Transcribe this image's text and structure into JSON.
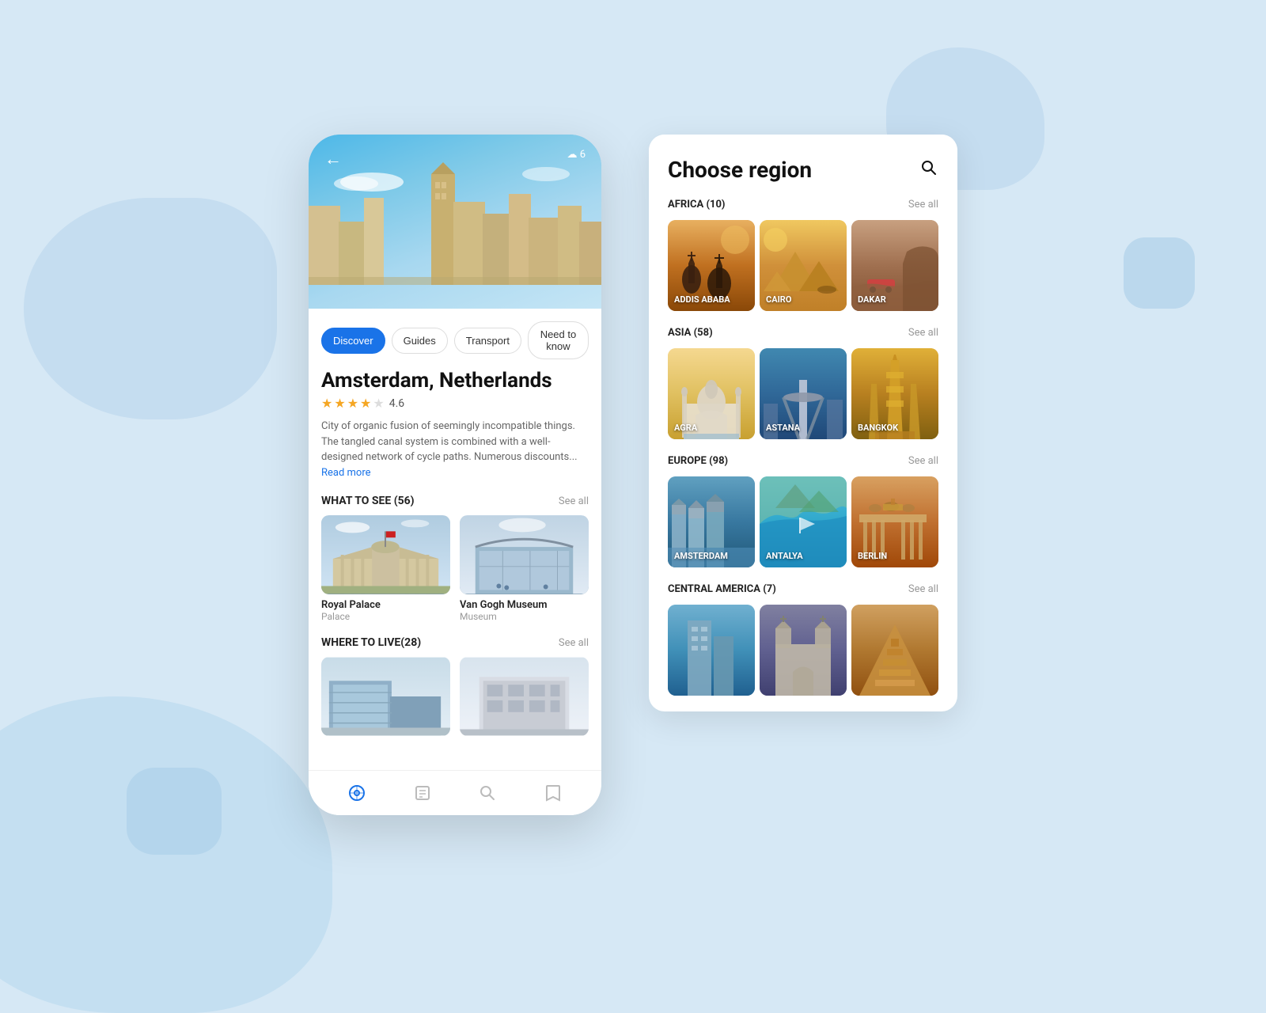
{
  "background": {
    "color": "#d6e8f5"
  },
  "left_phone": {
    "hero": {
      "back_label": "←",
      "weather_label": "☁ 6"
    },
    "tabs": [
      {
        "id": "discover",
        "label": "Discover",
        "active": true
      },
      {
        "id": "guides",
        "label": "Guides",
        "active": false
      },
      {
        "id": "transport",
        "label": "Transport",
        "active": false
      },
      {
        "id": "need_to_know",
        "label": "Need to know",
        "active": false
      }
    ],
    "city_title": "Amsterdam, Netherlands",
    "rating": {
      "value": "4.6",
      "stars": [
        true,
        true,
        true,
        true,
        false
      ]
    },
    "description": "City of organic fusion of seemingly incompatible things. The tangled canal system is combined with a well-designed network of cycle paths. Numerous discounts...",
    "read_more_label": "Read more",
    "what_to_see": {
      "title": "WHAT TO SEE (56)",
      "see_all_label": "See all",
      "places": [
        {
          "name": "Royal Palace",
          "type": "Palace"
        },
        {
          "name": "Van Gogh Museum",
          "type": "Museum"
        }
      ]
    },
    "where_to_live": {
      "title": "WHERE TO LIVE(28)",
      "see_all_label": "See all"
    },
    "nav": [
      {
        "icon": "🌐",
        "active": true
      },
      {
        "icon": "🖼",
        "active": false
      },
      {
        "icon": "🔍",
        "active": false
      },
      {
        "icon": "🔖",
        "active": false
      }
    ]
  },
  "right_panel": {
    "title": "Choose region",
    "search_icon": "🔍",
    "regions": [
      {
        "name": "AFRICA (10)",
        "see_all": "See all",
        "cities": [
          {
            "name": "ADDIS ABABA",
            "style_class": "africa1"
          },
          {
            "name": "CAIRO",
            "style_class": "africa2"
          },
          {
            "name": "DAKAR",
            "style_class": "africa3"
          }
        ]
      },
      {
        "name": "ASIA (58)",
        "see_all": "See all",
        "cities": [
          {
            "name": "AGRA",
            "style_class": "asia1"
          },
          {
            "name": "ASTANA",
            "style_class": "asia2"
          },
          {
            "name": "BANGKOK",
            "style_class": "asia3"
          }
        ]
      },
      {
        "name": "EUROPE (98)",
        "see_all": "See all",
        "cities": [
          {
            "name": "AMSTERDAM",
            "style_class": "europe1"
          },
          {
            "name": "ANTALYA",
            "style_class": "europe2"
          },
          {
            "name": "BERLIN",
            "style_class": "europe3"
          }
        ]
      },
      {
        "name": "CENTRAL AMERICA (7)",
        "see_all": "See all",
        "cities": [
          {
            "name": "",
            "style_class": "central1"
          },
          {
            "name": "",
            "style_class": "central2"
          },
          {
            "name": "",
            "style_class": "central3"
          }
        ]
      }
    ]
  }
}
